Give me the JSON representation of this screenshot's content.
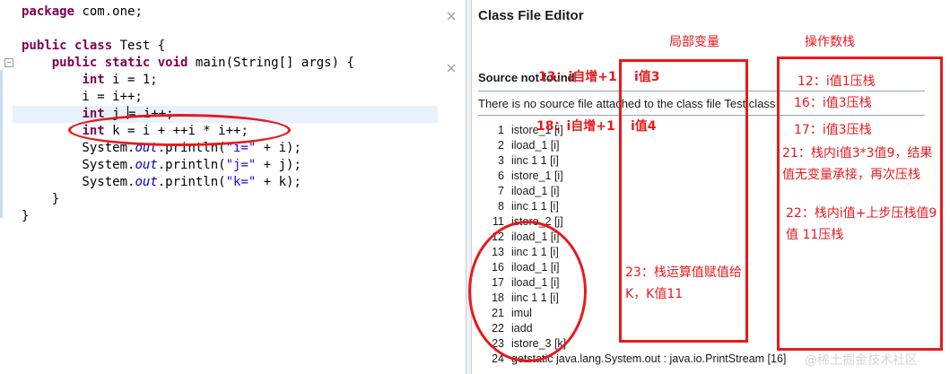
{
  "editor": {
    "lines": [
      {
        "tokens": [
          {
            "t": "package",
            "c": "kw"
          },
          {
            "t": " com.one;"
          }
        ]
      },
      {
        "tokens": []
      },
      {
        "tokens": [
          {
            "t": "public",
            "c": "kw"
          },
          {
            "t": " "
          },
          {
            "t": "class",
            "c": "kw"
          },
          {
            "t": " Test {"
          }
        ]
      },
      {
        "tokens": [
          {
            "t": "    "
          },
          {
            "t": "public",
            "c": "kw"
          },
          {
            "t": " "
          },
          {
            "t": "static",
            "c": "kw"
          },
          {
            "t": " "
          },
          {
            "t": "void",
            "c": "kw"
          },
          {
            "t": " main(String[] args) {"
          }
        ]
      },
      {
        "tokens": [
          {
            "t": "        "
          },
          {
            "t": "int",
            "c": "kw"
          },
          {
            "t": " i = 1;"
          }
        ]
      },
      {
        "tokens": [
          {
            "t": "        i = i++;"
          }
        ]
      },
      {
        "tokens": [
          {
            "t": "        "
          },
          {
            "t": "int",
            "c": "kw"
          },
          {
            "t": " j "
          },
          {
            "t": "",
            "c": "caret"
          },
          {
            "t": "= i++;"
          }
        ],
        "highlight": true
      },
      {
        "tokens": [
          {
            "t": "        "
          },
          {
            "t": "int",
            "c": "kw"
          },
          {
            "t": " k = i + ++i * i++;"
          }
        ]
      },
      {
        "tokens": [
          {
            "t": "        System."
          },
          {
            "t": "out",
            "c": "fld"
          },
          {
            "t": ".println("
          },
          {
            "t": "\"i=\"",
            "c": "str"
          },
          {
            "t": " + i);"
          }
        ]
      },
      {
        "tokens": [
          {
            "t": "        System."
          },
          {
            "t": "out",
            "c": "fld"
          },
          {
            "t": ".println("
          },
          {
            "t": "\"j=\"",
            "c": "str"
          },
          {
            "t": " + j);"
          }
        ]
      },
      {
        "tokens": [
          {
            "t": "        System."
          },
          {
            "t": "out",
            "c": "fld"
          },
          {
            "t": ".println("
          },
          {
            "t": "\"k=\"",
            "c": "str"
          },
          {
            "t": " + k);"
          }
        ]
      },
      {
        "tokens": [
          {
            "t": "    }"
          }
        ]
      },
      {
        "tokens": [
          {
            "t": "}"
          }
        ]
      }
    ]
  },
  "class_file_editor": {
    "title": "Class File Editor",
    "source_heading": "Source not found",
    "message": "There is no source file attached to the class file Test.class",
    "bytecode": [
      {
        "offset": "1",
        "op": "istore_1 [i]"
      },
      {
        "offset": "2",
        "op": "iload_1 [i]"
      },
      {
        "offset": "3",
        "op": "iinc 1 1 [i]"
      },
      {
        "offset": "6",
        "op": "istore_1 [i]"
      },
      {
        "offset": "7",
        "op": "iload_1 [i]"
      },
      {
        "offset": "8",
        "op": "iinc 1 1 [i]"
      },
      {
        "offset": "11",
        "op": "istore_2 [j]"
      },
      {
        "offset": "12",
        "op": "iload_1 [i]"
      },
      {
        "offset": "13",
        "op": "iinc 1 1 [i]"
      },
      {
        "offset": "16",
        "op": "iload_1 [i]"
      },
      {
        "offset": "17",
        "op": "iload_1 [i]"
      },
      {
        "offset": "18",
        "op": "iinc 1 1 [i]"
      },
      {
        "offset": "21",
        "op": "imul"
      },
      {
        "offset": "22",
        "op": "iadd"
      },
      {
        "offset": "23",
        "op": "istore_3 [k]"
      },
      {
        "offset": "24",
        "op": "getstatic java.lang.System.out : java.io.PrintStream [16]"
      }
    ]
  },
  "annotations": {
    "local_vars_header": "局部变量",
    "operand_stack_header": "操作数栈",
    "local_vars": {
      "step13": "13：i自增+1",
      "val3": "i值3",
      "step18": "18：i自增+1",
      "val4": "i值4",
      "step23": "23：栈运算值赋值给K，K值11"
    },
    "operand_stack": {
      "s12": "12：i值1压栈",
      "s16": "16：i值3压栈",
      "s17": "17：i值3压栈",
      "s21": "21：栈内i值3*3值9，结果值无变量承接，再次压栈",
      "s22": "22：栈内i值+上步压栈值9 值 11压栈"
    }
  },
  "watermark": "@稀土掘金技术社区",
  "colors": {
    "annotation": "#e8191d",
    "keyword": "#7f0055",
    "string": "#2a00ff",
    "field": "#0000c0",
    "highlight": "#e8f2fe"
  }
}
